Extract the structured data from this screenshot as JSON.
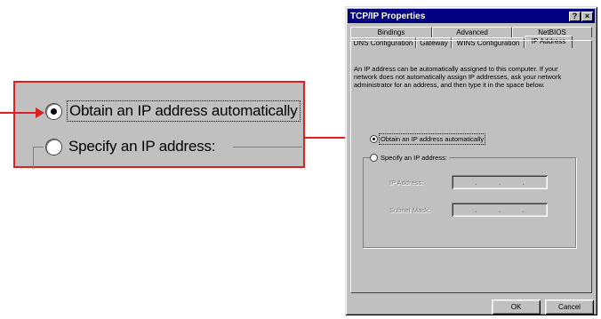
{
  "dialog": {
    "title": "TCP/IP Properties",
    "help_button": "?",
    "close_button": "×",
    "tabs_back": [
      "Bindings",
      "Advanced",
      "NetBIOS"
    ],
    "tabs_front": [
      "DNS Configuration",
      "Gateway",
      "WINS Configuration",
      "IP Address"
    ],
    "active_tab": "IP Address",
    "description": "An IP address can be automatically assigned to this computer. If your network does not automatically assign IP addresses, ask your network administrator for an address, and then type it in the space below.",
    "option_auto": "Obtain an IP address automatically",
    "option_specify": "Specify an IP address:",
    "ip_address_label": "IP Address:",
    "subnet_mask_label": "Subnet Mask:",
    "dot": ".",
    "ok_label": "OK",
    "cancel_label": "Cancel"
  },
  "zoom": {
    "option_auto": "Obtain an IP address automatically",
    "option_specify": "Specify an IP address:"
  },
  "colors": {
    "accent": "#e02020",
    "titlebar": "#000080",
    "face": "#c0c0c0"
  }
}
